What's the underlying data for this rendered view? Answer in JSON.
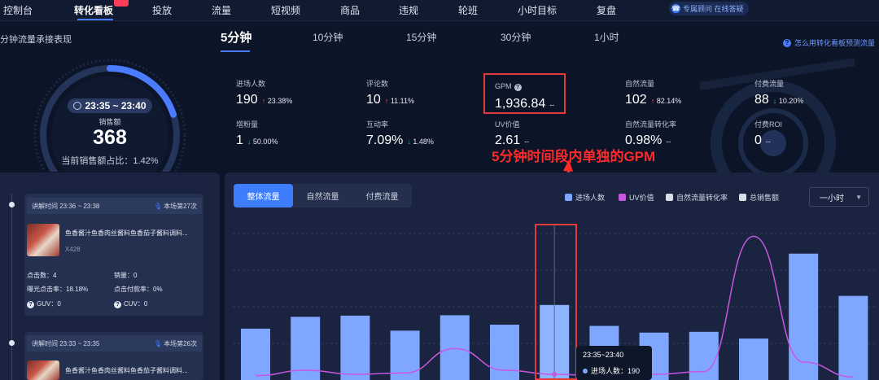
{
  "nav": {
    "items": [
      "控制台",
      "转化看板",
      "投放",
      "流量",
      "短视频",
      "商品",
      "违规",
      "轮班",
      "小时目标",
      "复盘"
    ],
    "active_index": 1,
    "consult_label": "专属顾问 在线答疑"
  },
  "subheader": {
    "title": "分钟流量承接表现",
    "tabs": [
      "5分钟",
      "10分钟",
      "15分钟",
      "30分钟",
      "1小时"
    ],
    "active_tab_index": 0,
    "help_link": "怎么用转化看板预测流量"
  },
  "gauge": {
    "time_range": "23:35 ~ 23:40",
    "label": "销售额",
    "value": "368",
    "ratio_text": "当前销售额占比：1.42%",
    "ratio_fraction": 0.0142
  },
  "metrics": [
    {
      "label": "进场人数",
      "value": "190",
      "change": "23.38%",
      "direction": "up"
    },
    {
      "label": "评论数",
      "value": "10",
      "change": "11.11%",
      "direction": "up"
    },
    {
      "label": "GPM",
      "value": "1,936.84",
      "change": "--",
      "direction": "none",
      "help": true
    },
    {
      "label": "自然流量",
      "value": "102",
      "change": "82.14%",
      "direction": "up"
    },
    {
      "label": "付费流量",
      "value": "88",
      "change": "10.20%",
      "direction": "down"
    },
    {
      "label": "增粉量",
      "value": "1",
      "change": "50.00%",
      "direction": "down"
    },
    {
      "label": "互动率",
      "value": "7.09%",
      "change": "1.48%",
      "direction": "down"
    },
    {
      "label": "UV价值",
      "value": "2.61",
      "change": "--",
      "direction": "none"
    },
    {
      "label": "自然流量转化率",
      "value": "0.98%",
      "change": "--",
      "direction": "none"
    },
    {
      "label": "付费ROI",
      "value": "0",
      "change": "--",
      "direction": "none"
    }
  ],
  "annotation": "5分钟时间段内单独的GPM",
  "cards": [
    {
      "time": "讲解时间 23:36 ~ 23:38",
      "session": "本场第27次",
      "product_title": "鱼香酱汁鱼香肉丝酱料鱼香茄子酱料调料...",
      "qty": "X428",
      "clicks": "点击数：4",
      "sales": "销量：0",
      "ctr": "曝光点击率：18.18%",
      "cvr": "点击付款率：0%",
      "guv": "GUV：0",
      "cuv": "CUV：0"
    },
    {
      "time": "讲解时间 23:33 ~ 23:35",
      "session": "本场第26次",
      "product_title": "鱼香酱汁鱼香肉丝酱料鱼香茄子酱料调料..."
    }
  ],
  "chart_tabs": [
    "整体流量",
    "自然流量",
    "付费流量"
  ],
  "chart_tab_active": 0,
  "legend": [
    {
      "name": "进场人数",
      "color": "#7fa7ff"
    },
    {
      "name": "UV价值",
      "color": "#c956e0"
    },
    {
      "name": "自然流量转化率",
      "color": "#d9dde6"
    },
    {
      "name": "总销售额",
      "color": "#d9dde6"
    }
  ],
  "range_select": "一小时",
  "tooltip": {
    "time": "23:35~23:40",
    "row": "进场人数：190"
  },
  "chart_data": {
    "type": "bar",
    "series": [
      {
        "name": "进场人数",
        "type": "bar",
        "color": "#7fa7ff",
        "values": [
          130,
          160,
          163,
          125,
          164,
          140,
          190,
          137,
          120,
          122,
          105,
          320,
          213
        ]
      },
      {
        "name": "UV价值",
        "type": "line",
        "color": "#c956e0",
        "values": [
          0.2,
          0.6,
          0.3,
          0.4,
          2.2,
          0.6,
          0.3,
          0.2,
          0.3,
          0.5,
          10.5,
          1.2,
          0.1
        ]
      }
    ],
    "highlight_index": 6
  }
}
